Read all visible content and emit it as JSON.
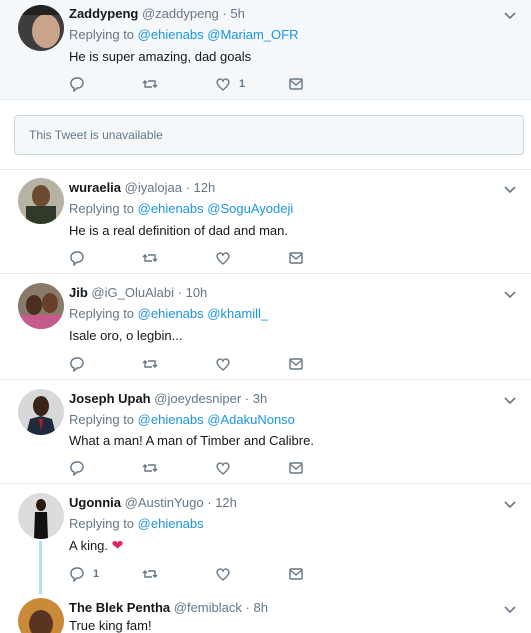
{
  "tweets": [
    {
      "name": "Zaddypeng",
      "handle": "@zaddypeng",
      "time": "5h",
      "replying_prefix": "Replying to",
      "replying_to": [
        "@ehienabs",
        "@Mariam_OFR"
      ],
      "text": "He is super amazing, dad goals",
      "like_count": "1",
      "reply_count": ""
    },
    {
      "name": "wuraelia",
      "handle": "@iyalojaa",
      "time": "12h",
      "replying_prefix": "Replying to",
      "replying_to": [
        "@ehienabs",
        "@SoguAyodeji"
      ],
      "text": "He is a real definition of dad and man."
    },
    {
      "name": "Jib",
      "handle": "@iG_OluAlabi",
      "time": "10h",
      "replying_prefix": "Replying to",
      "replying_to": [
        "@ehienabs",
        "@khamill_"
      ],
      "text": "Isale oro, o legbin..."
    },
    {
      "name": "Joseph Upah",
      "handle": "@joeydesniper",
      "time": "3h",
      "replying_prefix": "Replying to",
      "replying_to": [
        "@ehienabs",
        "@AdakuNonso"
      ],
      "text": "What a man! A man of Timber and Calibre."
    },
    {
      "name": "Ugonnia",
      "handle": "@AustinYugo",
      "time": "12h",
      "replying_prefix": "Replying to",
      "replying_to": [
        "@ehienabs"
      ],
      "text": "A king.",
      "reply_count": "1"
    },
    {
      "name": "The Blek Pentha",
      "handle": "@femiblack",
      "time": "8h",
      "text": "True king fam!"
    }
  ],
  "unavailable_text": "This Tweet is unavailable",
  "separator": "·",
  "colors": {
    "link": "#1b95e0",
    "muted": "#657786",
    "thread_line": "#b9def3",
    "heart": "#e0245e"
  },
  "icons": [
    "chevron-down-icon",
    "reply-icon",
    "retweet-icon",
    "like-icon",
    "message-icon",
    "heart-emoji-icon"
  ]
}
